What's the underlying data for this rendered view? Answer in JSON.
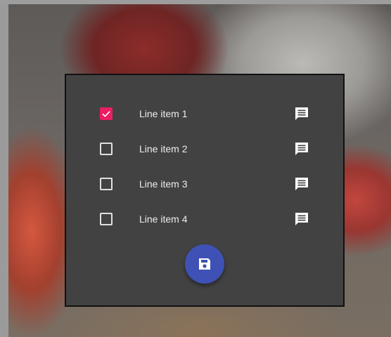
{
  "items": [
    {
      "label": "Line item 1",
      "checked": true
    },
    {
      "label": "Line item 2",
      "checked": false
    },
    {
      "label": "Line item 3",
      "checked": false
    },
    {
      "label": "Line item 4",
      "checked": false
    }
  ],
  "row_icon": "comment-icon",
  "fab_icon": "save-icon",
  "colors": {
    "dialog_background": "#424242",
    "checkbox_checked": "#e91e63",
    "fab": "#3f51b5",
    "text": "#ededed"
  }
}
